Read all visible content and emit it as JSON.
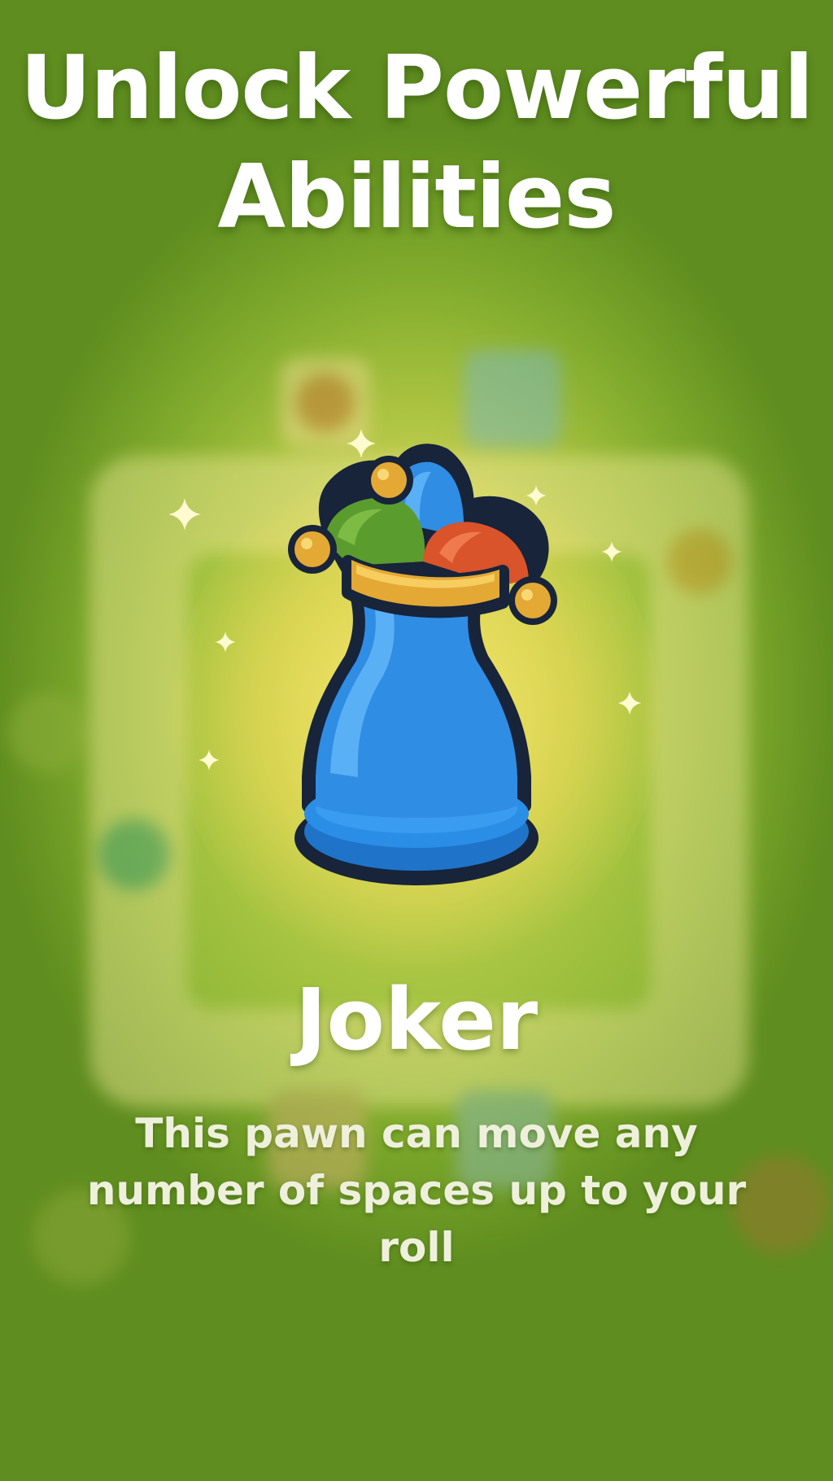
{
  "screen": {
    "title_line1": "Unlock Powerful",
    "title_line2": "Abilities",
    "ability_name": "Joker",
    "ability_description": "This pawn can move any number of spaces up to your roll",
    "piece_icon": "joker-pawn-icon",
    "colors": {
      "pawn_blue": "#2f8de4",
      "hat_green": "#5b9c2e",
      "hat_red": "#d9532b",
      "hat_blue": "#2f8de4",
      "hat_band_gold": "#e3a934",
      "background_green": "#6f9e25",
      "glow_yellow": "#f6df6e"
    }
  }
}
